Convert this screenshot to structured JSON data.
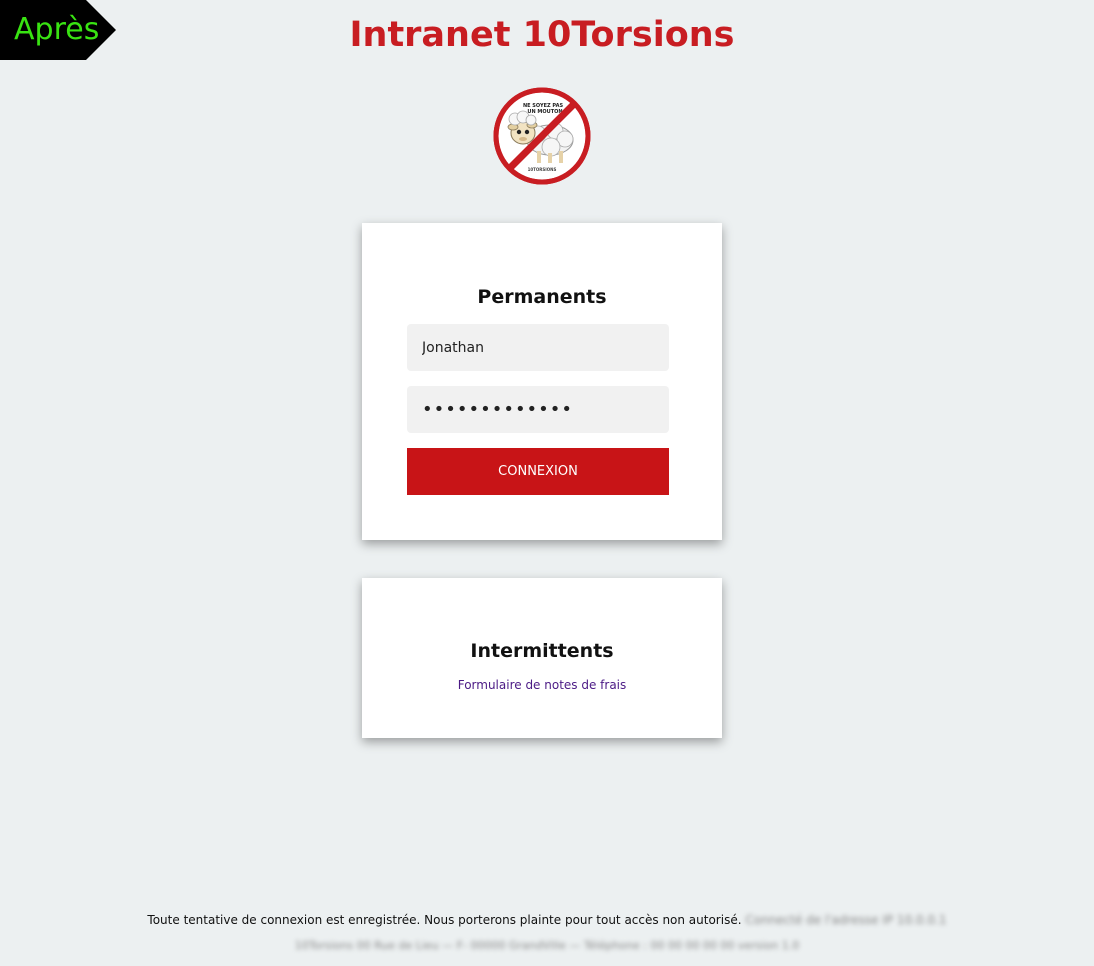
{
  "badge": {
    "label": "Après"
  },
  "header": {
    "title": "Intranet 10Torsions"
  },
  "logo": {
    "text_top": "NE SOYEZ PAS",
    "text_mid": "UN MOUTON !",
    "text_bottom": "10TORSIONS",
    "ring_color": "#c81d22"
  },
  "permanents": {
    "title": "Permanents",
    "username_value": "Jonathan",
    "password_value": "•••••••••••••",
    "login_label": "CONNEXION"
  },
  "intermittents": {
    "title": "Intermittents",
    "link_label": "Formulaire de notes de frais"
  },
  "footer": {
    "notice": "Toute tentative de connexion est enregistrée. Nous porterons plainte pour tout accès non autorisé.",
    "blurred_ip": "Connecté de l'adresse IP 10.0.0.1",
    "blurred_address": "10Torsions 00 Rue de Lieu — F- 00000 GrandVille — Téléphone : 00 00 00 00 00 version 1.0"
  },
  "colors": {
    "accent": "#c81d22",
    "button": "#c81417",
    "background": "#ecf0f1",
    "badge_text": "#39e312",
    "link": "#4b1a85"
  }
}
